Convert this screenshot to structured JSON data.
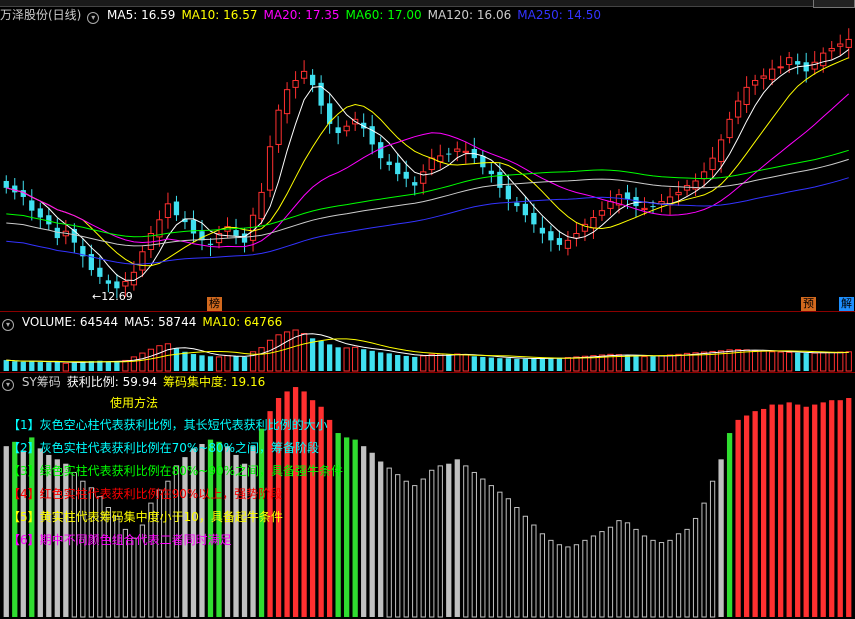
{
  "stock_title": "万泽股份(日线)",
  "ma_labels": [
    {
      "text": "MA5: 16.59",
      "color": "#ffffff"
    },
    {
      "text": "MA10: 16.57",
      "color": "#ffff00"
    },
    {
      "text": "MA20: 17.35",
      "color": "#ff00ff"
    },
    {
      "text": "MA60: 17.00",
      "color": "#00ff00"
    },
    {
      "text": "MA120: 16.06",
      "color": "#cccccc"
    },
    {
      "text": "MA250: 14.50",
      "color": "#3333ff"
    }
  ],
  "low_marker": "←12.69",
  "tags": {
    "bang": "榜",
    "yu": "预",
    "jie": "解"
  },
  "volume_labels": [
    {
      "text": "VOLUME: 64544",
      "color": "#ffffff"
    },
    {
      "text": "MA5: 58744",
      "color": "#ffffff"
    },
    {
      "text": "MA10: 64766",
      "color": "#ffff00"
    }
  ],
  "sy_labels": [
    {
      "text": "SY筹码",
      "color": "#cccccc"
    },
    {
      "text": "获利比例: 59.94",
      "color": "#ffffff"
    },
    {
      "text": "筹码集中度: 19.16",
      "color": "#ffff00"
    }
  ],
  "usage_title": "使用方法",
  "notes": [
    {
      "text": "【1】灰色空心柱代表获利比例，其长短代表获利比例的大小",
      "color": "#00ffff"
    },
    {
      "text": "【2】灰色实柱代表获利比例在70%~80%之间，筹备阶段",
      "color": "#00ffff"
    },
    {
      "text": "【3】绿色实柱代表获利比例在80%~90%之间，具备强牛条件",
      "color": "#00ff00"
    },
    {
      "text": "【4】红色实柱代表获利比例在90%以上，强势阶段",
      "color": "#ff0000"
    },
    {
      "text": "【5】黄实柱代表筹码集中度小于10，具备起牛条件",
      "color": "#ffff00"
    },
    {
      "text": "【6】期中不同颜色组合代表二者同时满足",
      "color": "#ff00ff"
    }
  ],
  "chart_data": [
    {
      "type": "candlestick",
      "title": "万泽股份(日线)",
      "series": [
        {
          "name": "MA5",
          "value": 16.59
        },
        {
          "name": "MA10",
          "value": 16.57
        },
        {
          "name": "MA20",
          "value": 17.35
        },
        {
          "name": "MA60",
          "value": 17.0
        },
        {
          "name": "MA120",
          "value": 16.06
        },
        {
          "name": "MA250",
          "value": 14.5
        }
      ],
      "close": [
        17.2,
        17.0,
        16.8,
        16.2,
        15.9,
        15.6,
        15.0,
        15.3,
        14.8,
        14.2,
        13.6,
        13.3,
        13.0,
        12.8,
        13.1,
        13.5,
        14.4,
        15.2,
        15.8,
        16.5,
        16.0,
        15.7,
        15.2,
        14.9,
        14.7,
        15.2,
        15.5,
        15.1,
        14.8,
        16.0,
        17.0,
        19.0,
        20.6,
        21.5,
        21.9,
        22.3,
        21.7,
        20.8,
        20.0,
        19.6,
        19.9,
        20.2,
        19.8,
        19.1,
        18.5,
        18.2,
        17.8,
        17.6,
        17.3,
        17.9,
        18.5,
        18.6,
        18.7,
        18.9,
        18.8,
        18.5,
        18.1,
        17.8,
        17.2,
        16.7,
        16.4,
        16.0,
        15.6,
        15.2,
        14.9,
        14.7,
        14.9,
        15.2,
        15.6,
        15.9,
        16.2,
        16.6,
        16.9,
        16.7,
        16.4,
        16.3,
        16.4,
        16.6,
        16.8,
        17.0,
        17.3,
        17.5,
        17.9,
        18.5,
        19.3,
        20.2,
        21.0,
        21.6,
        21.9,
        22.1,
        22.4,
        22.5,
        22.9,
        22.6,
        22.3,
        22.7,
        23.1,
        23.3,
        23.5,
        23.7
      ]
    },
    {
      "type": "bar",
      "title": "VOLUME",
      "series": [
        {
          "name": "VOLUME",
          "value": 64544
        },
        {
          "name": "MA5",
          "value": 58744
        },
        {
          "name": "MA10",
          "value": 64766
        }
      ],
      "values": [
        34,
        30,
        29,
        31,
        28,
        27,
        30,
        24,
        26,
        28,
        31,
        32,
        29,
        30,
        33,
        44,
        56,
        68,
        79,
        85,
        70,
        60,
        53,
        49,
        46,
        44,
        48,
        46,
        44,
        60,
        73,
        96,
        113,
        122,
        128,
        117,
        102,
        94,
        83,
        74,
        72,
        74,
        68,
        63,
        58,
        55,
        50,
        47,
        44,
        47,
        52,
        53,
        51,
        53,
        50,
        46,
        44,
        42,
        40,
        40,
        38,
        38,
        39,
        40,
        41,
        40,
        42,
        44,
        46,
        48,
        50,
        52,
        51,
        49,
        46,
        45,
        46,
        48,
        50,
        52,
        55,
        57,
        59,
        61,
        63,
        66,
        67,
        66,
        64,
        62,
        60,
        59,
        58,
        57,
        56,
        56,
        57,
        58,
        59,
        60
      ]
    },
    {
      "type": "bar",
      "title": "SY筹码",
      "series": [
        {
          "name": "获利比例",
          "value": 59.94
        },
        {
          "name": "筹码集中度",
          "value": 19.16
        }
      ],
      "values": [
        78,
        80,
        76,
        82,
        77,
        74,
        72,
        70,
        66,
        62,
        59,
        55,
        50,
        46,
        40,
        36,
        42,
        52,
        58,
        62,
        69,
        73,
        77,
        79,
        81,
        80,
        78,
        74,
        70,
        78,
        86,
        94,
        100,
        103,
        105,
        103,
        99,
        96,
        90,
        84,
        82,
        81,
        78,
        75,
        71,
        68,
        65,
        62,
        60,
        63,
        67,
        69,
        70,
        72,
        69,
        66,
        63,
        60,
        57,
        54,
        50,
        46,
        42,
        38,
        35,
        33,
        32,
        33,
        35,
        37,
        39,
        41,
        44,
        43,
        40,
        37,
        35,
        34,
        35,
        38,
        40,
        45,
        52,
        62,
        72,
        84,
        90,
        92,
        94,
        95,
        97,
        97,
        98,
        97,
        96,
        97,
        98,
        99,
        99,
        100
      ],
      "ylim": [
        0,
        100
      ]
    }
  ]
}
